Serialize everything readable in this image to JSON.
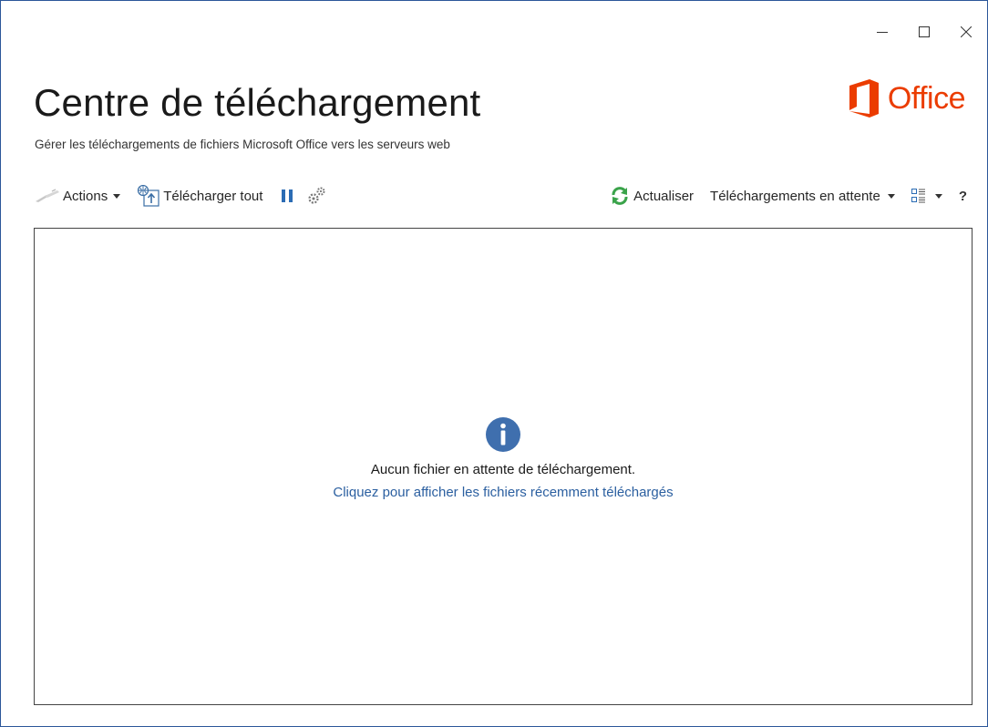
{
  "window": {
    "minimize_icon": "minimize-icon",
    "maximize_icon": "maximize-icon",
    "close_icon": "close-icon"
  },
  "header": {
    "title": "Centre de téléchargement",
    "subtitle": "Gérer les téléchargements de fichiers Microsoft Office vers les serveurs web",
    "brand": "Office",
    "brand_color": "#eb3c00"
  },
  "toolbar": {
    "actions_label": "Actions",
    "upload_all_label": "Télécharger tout",
    "refresh_label": "Actualiser",
    "filter_label": "Téléchargements en attente",
    "help_label": "?"
  },
  "content": {
    "empty_message": "Aucun fichier en attente de téléchargement.",
    "recent_link": "Cliquez pour afficher les fichiers récemment téléchargés"
  },
  "colors": {
    "accent": "#2b579a",
    "link": "#2b5fa0",
    "info": "#3f6fae",
    "refresh": "#3aa34a"
  }
}
